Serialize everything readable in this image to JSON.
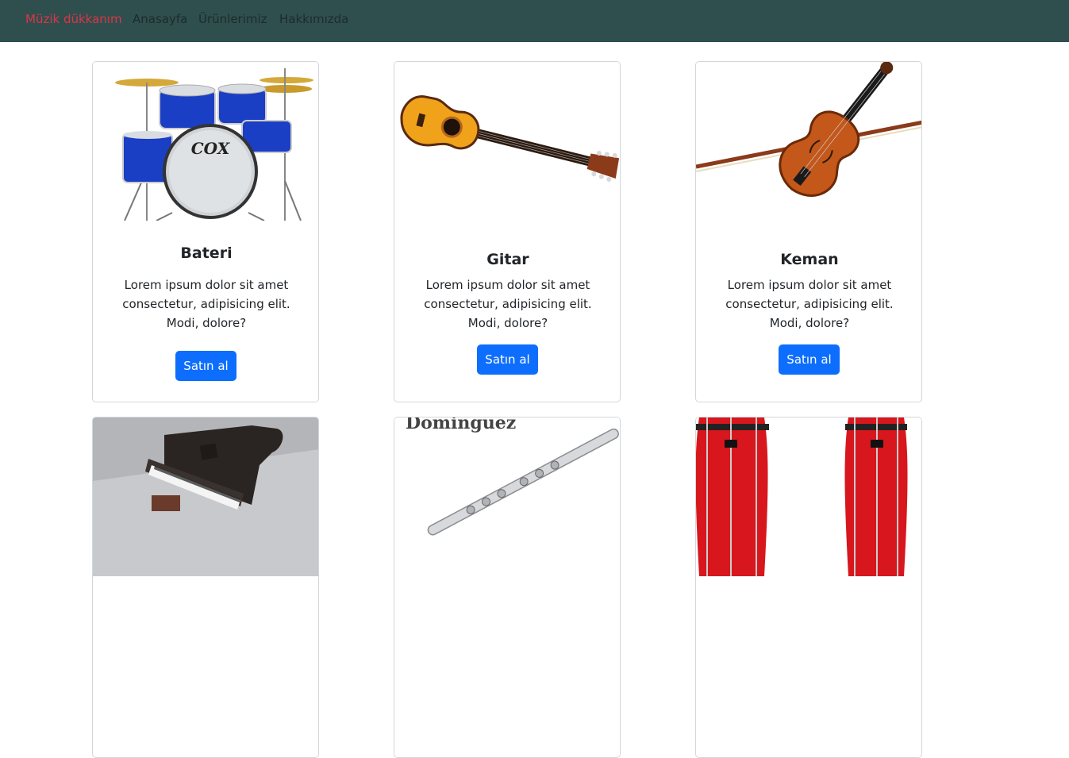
{
  "navbar": {
    "brand": "Müzik dükkanım",
    "links": [
      "Anasayfa",
      "Ürünlerimiz",
      "Hakkımızda"
    ]
  },
  "products": [
    {
      "title": "Bateri",
      "text": "Lorem ipsum dolor sit amet consectetur, adipisicing elit. Modi, dolore?",
      "button": "Satın al",
      "image_text": "COX"
    },
    {
      "title": "Gitar",
      "text": "Lorem ipsum dolor sit amet consectetur, adipisicing elit. Modi, dolore?",
      "button": "Satın al"
    },
    {
      "title": "Keman",
      "text": "Lorem ipsum dolor sit amet consectetur, adipisicing elit. Modi, dolore?",
      "button": "Satın al"
    },
    {
      "image": "piano"
    },
    {
      "image": "flute",
      "image_text": "Dominguez"
    },
    {
      "image": "conga"
    }
  ],
  "colors": {
    "navbar_bg": "#2f4f4f",
    "brand": "#dc3545",
    "button_bg": "#0d6efd"
  }
}
